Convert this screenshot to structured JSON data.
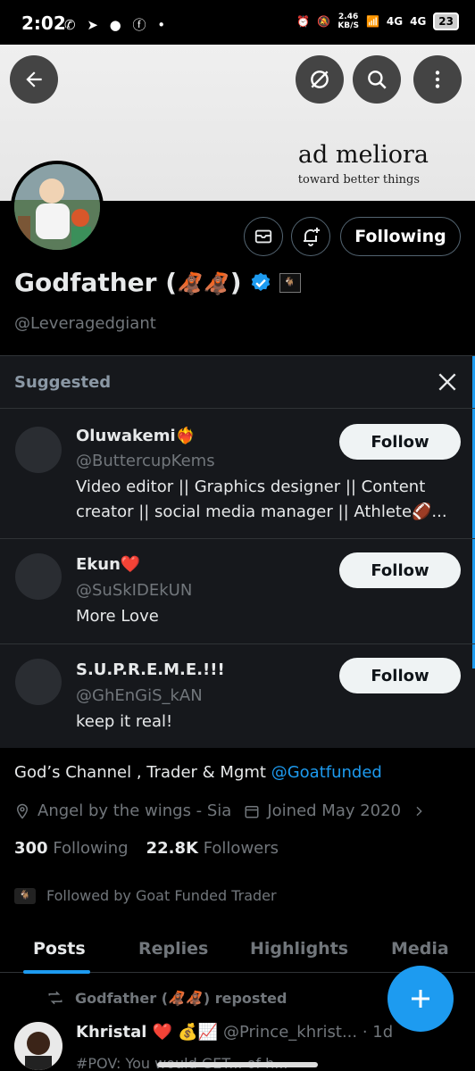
{
  "status_bar": {
    "time": "2:02",
    "notif_icons": "✆ ➤ ● ⓕ •",
    "net_speed_value": "2.46",
    "net_speed_unit": "KB/S",
    "signal1": "4G",
    "signal2": "4G",
    "battery": "23"
  },
  "banner": {
    "title": "ad meliora",
    "subtitle": "toward better things"
  },
  "profile": {
    "display_name": "Godfather (",
    "name_emoji": "🦧🦧",
    "name_close": ")",
    "handle": "@Leveragedgiant",
    "following_label": "Following",
    "bio_text": "God’s Channel , Trader & Mgmt ",
    "bio_mention": "@Goatfunded",
    "location": "Angel by the wings - Sia",
    "joined": "Joined May 2020",
    "following_count": "300",
    "following_label_stat": "Following",
    "followers_count": "22.8K",
    "followers_label": "Followers",
    "followed_by": "Followed by Goat Funded Trader"
  },
  "suggested": {
    "title": "Suggested",
    "items": [
      {
        "name": "Oluwakemi❤️‍🔥",
        "handle": "@ButtercupKems",
        "bio": "Video editor || Graphics designer || Content creator || social media manager || Athlete🏈...",
        "button": "Follow"
      },
      {
        "name": "Ekun❤️",
        "handle": "@SuSkIDEkUN",
        "bio": "More Love",
        "button": "Follow"
      },
      {
        "name": "S.U.P.R.E.M.E.!!!",
        "handle": "@GhEnGiS_kAN",
        "bio": "keep it real!",
        "button": "Follow"
      }
    ]
  },
  "tabs": [
    {
      "label": "Posts",
      "active": true
    },
    {
      "label": "Replies",
      "active": false
    },
    {
      "label": "Highlights",
      "active": false
    },
    {
      "label": "Media",
      "active": false
    }
  ],
  "post": {
    "repost_label": "Godfather (🦧🦧) reposted",
    "author": "Khristal ❤️ 💰📈",
    "author_handle": "@Prince_khrist...",
    "time": "· 1d",
    "preview": "#POV: You would GET... of h..."
  },
  "colors": {
    "accent": "#1d9bf0",
    "background": "#000000",
    "card": "#16181c"
  }
}
